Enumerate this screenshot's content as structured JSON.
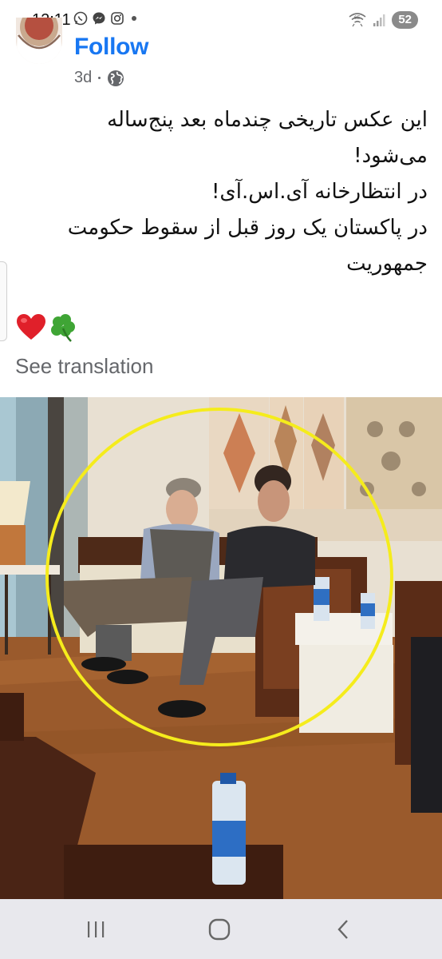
{
  "status_bar": {
    "time": "12:11",
    "battery": "52",
    "icons": [
      "whatsapp-icon",
      "messenger-icon",
      "instagram-icon",
      "wifi-6e-icon",
      "signal-icon"
    ]
  },
  "post": {
    "follow_label": "Follow",
    "time": "3d",
    "privacy_icon": "globe-icon",
    "text_lines": [
      "این عکس تاریخی چندماه بعد پنج‌ساله",
      "می‌شود!",
      "در انتظارخانه آی.اس.آی!",
      "در پاکستان یک روز قبل از سقوط حکومت",
      "جمهوریت"
    ],
    "emojis": [
      "heart-icon",
      "four-leaf-clover-icon"
    ],
    "see_translation": "See translation"
  },
  "nav_bar": {
    "buttons": [
      "recent-apps-icon",
      "home-icon",
      "back-icon"
    ]
  },
  "colors": {
    "accent": "#1877f2",
    "secondary_text": "#65676b",
    "highlight_circle": "#f5ec1c",
    "nav_background": "#e8e8ed"
  }
}
